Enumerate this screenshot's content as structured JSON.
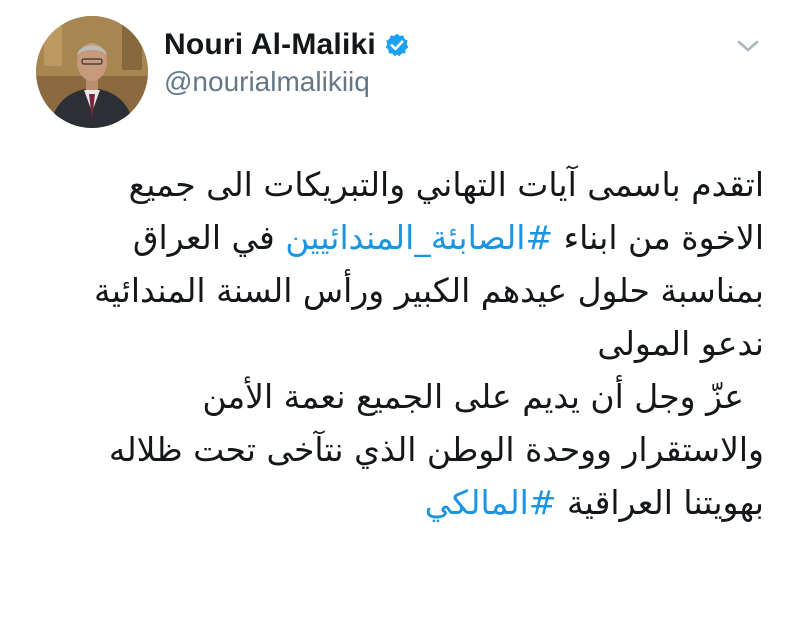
{
  "user": {
    "display_name": "Nouri Al-Maliki",
    "handle": "@nourialmalikiiq",
    "verified": true,
    "verified_icon": "verified-badge-icon",
    "avatar": "profile-photo"
  },
  "menu": {
    "icon": "chevron-down-icon"
  },
  "tweet": {
    "line1": "اتقدم باسمى آيات التهاني والتبريكات الى جميع",
    "line2_before": "الاخوة من ابناء ",
    "line2_hashtag": "#الصابئة_المندائيين",
    "line2_after": " في العراق",
    "line3": "بمناسبة حلول عيدهم الكبير ورأس السنة المندائية",
    "line4": "ندعو المولى",
    "line5": "عزّ وجل أن يديم على الجميع نعمة الأمن",
    "line6": "والاستقرار ووحدة الوطن الذي نتآخى تحت ظلاله",
    "line7_before": "بهويتنا العراقية ",
    "line7_hashtag": "#المالكي"
  },
  "colors": {
    "text": "#14171a",
    "secondary": "#657786",
    "link": "#1b95e0",
    "verified": "#1da1f2"
  }
}
